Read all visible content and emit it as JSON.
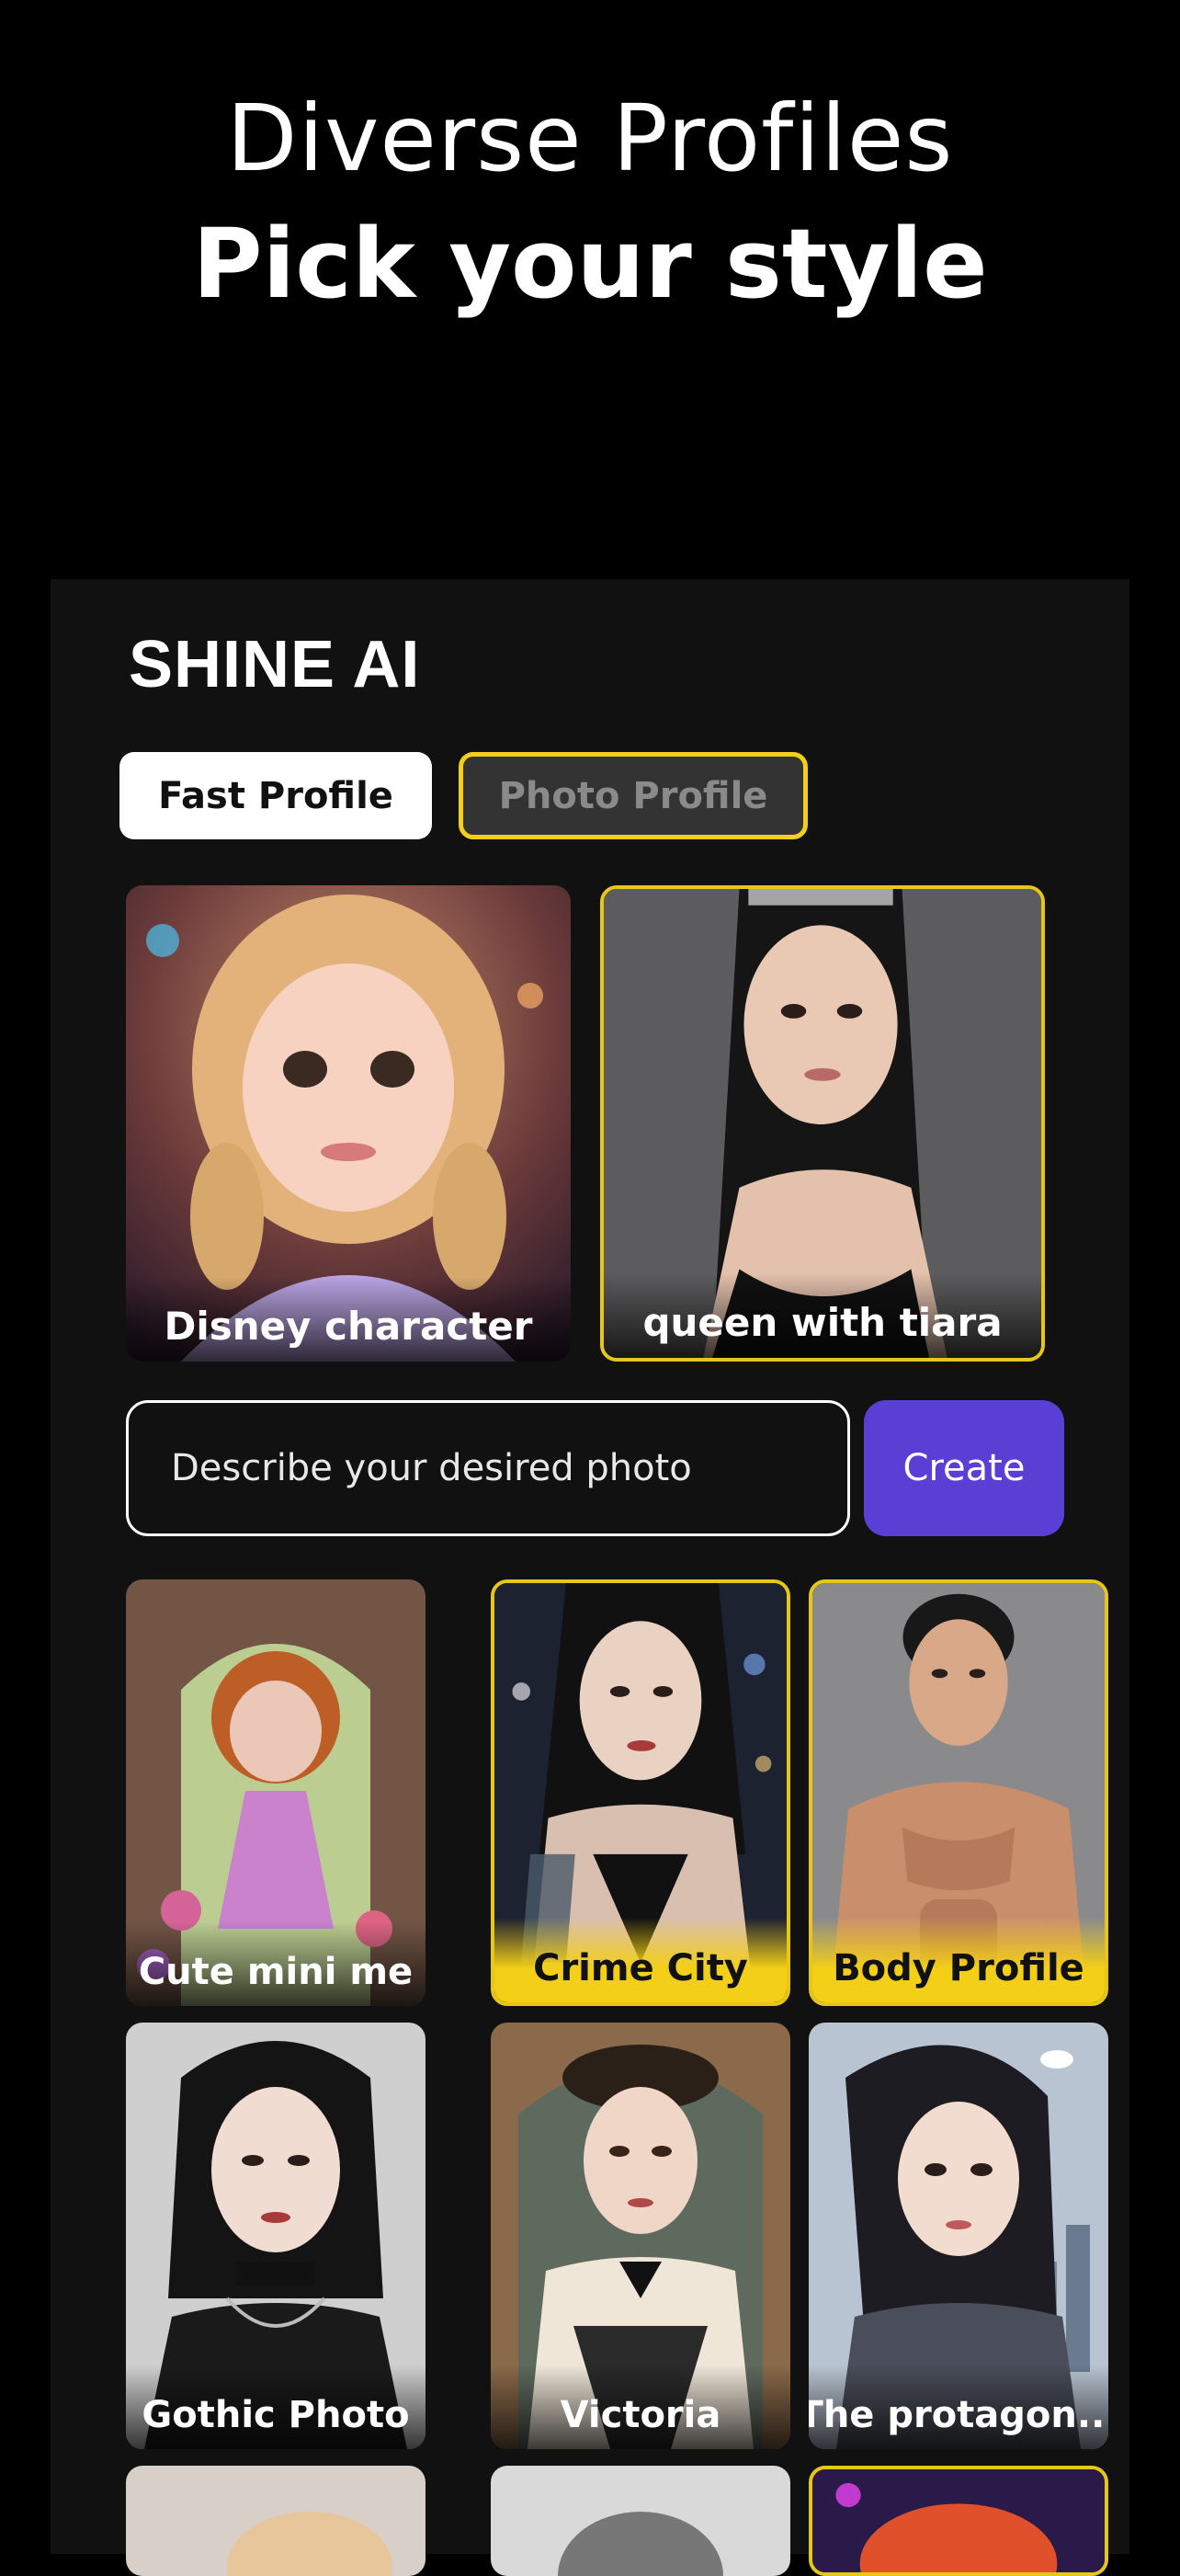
{
  "headline": {
    "line1": "Diverse Profiles",
    "line2": "Pick your style"
  },
  "app": {
    "brand": "SHINE AI",
    "tabs": [
      {
        "label": "Fast Profile",
        "active": true
      },
      {
        "label": "Photo Profile",
        "active": false
      }
    ]
  },
  "featured": [
    {
      "label": "Disney character"
    },
    {
      "label": "queen with tiara"
    }
  ],
  "prompt": {
    "placeholder": "Describe your desired photo",
    "button": "Create"
  },
  "styles": [
    {
      "label": "Cute mini me"
    },
    {
      "label": "Crime City"
    },
    {
      "label": "Body Profile"
    },
    {
      "label": "Gothic Photo"
    },
    {
      "label": "Victoria"
    },
    {
      "label": "The protagon..."
    }
  ],
  "colors": {
    "accent_yellow": "#f3cf17",
    "create_button": "#5a3fd4",
    "panel": "#111111"
  }
}
